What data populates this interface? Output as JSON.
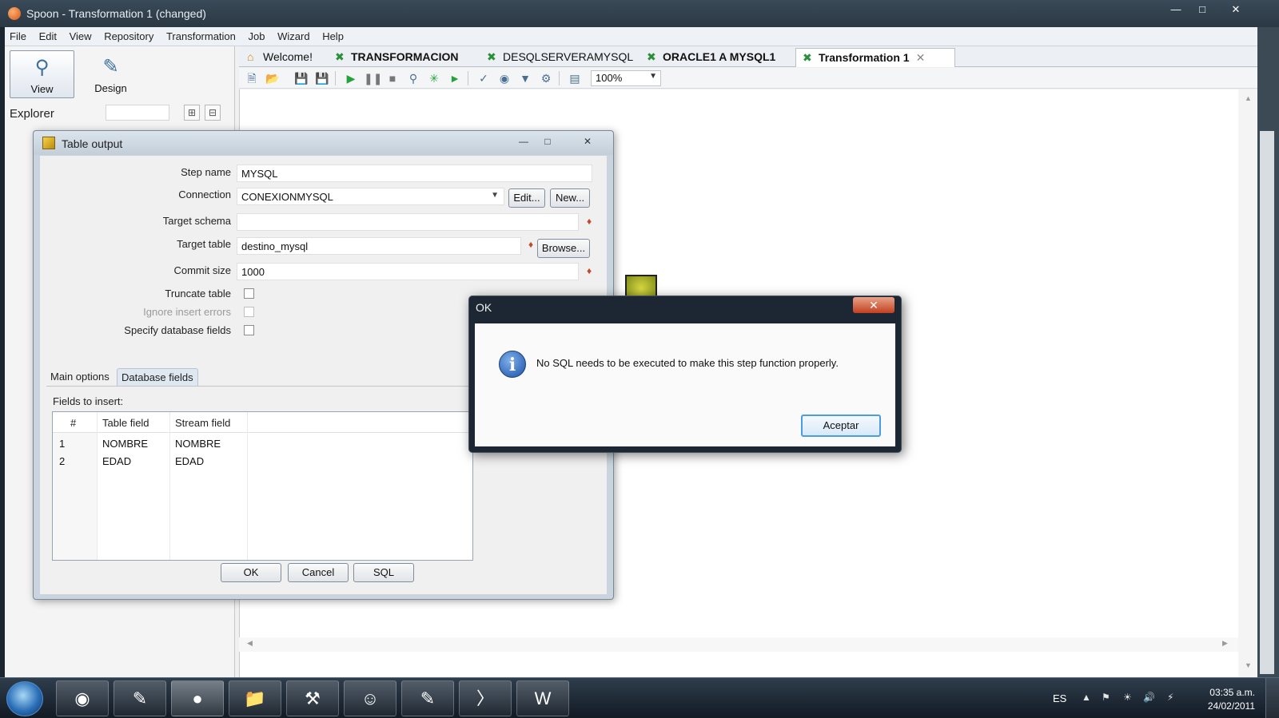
{
  "window": {
    "title": "Spoon - Transformation 1 (changed)"
  },
  "menu": [
    "File",
    "Edit",
    "View",
    "Repository",
    "Transformation",
    "Job",
    "Wizard",
    "Help"
  ],
  "perspectives": {
    "view": "View",
    "design": "Design"
  },
  "explorer": {
    "label": "Explorer"
  },
  "tabs": [
    "Welcome!",
    "TRANSFORMACION",
    "DESQLSERVERAMYSQL",
    "ORACLE1 A MYSQL1",
    "Transformation 1"
  ],
  "toolbar": {
    "zoom": "100%"
  },
  "table_output": {
    "title": "Table output",
    "step_name_label": "Step name",
    "step_name": "MYSQL",
    "connection_label": "Connection",
    "connection": "CONEXIONMYSQL",
    "edit_button": "Edit...",
    "new_button": "New...",
    "target_schema_label": "Target schema",
    "target_schema": "",
    "target_table_label": "Target table",
    "target_table": "destino_mysql",
    "browse_button": "Browse...",
    "commit_size_label": "Commit size",
    "commit_size": "1000",
    "truncate_label": "Truncate table",
    "truncate_checked": false,
    "ignore_errors_label": "Ignore insert errors",
    "ignore_errors_checked": false,
    "specify_fields_label": "Specify database fields",
    "specify_fields_checked": false,
    "subtabs": [
      "Main options",
      "Database fields"
    ],
    "fields_label": "Fields to insert:",
    "columns": [
      "#",
      "Table field",
      "Stream field"
    ],
    "rows": [
      {
        "n": "1",
        "table_field": "NOMBRE",
        "stream_field": "NOMBRE"
      },
      {
        "n": "2",
        "table_field": "EDAD",
        "stream_field": "EDAD"
      }
    ],
    "ok_button": "OK",
    "cancel_button": "Cancel",
    "sql_button": "SQL"
  },
  "message_box": {
    "title": "OK",
    "text": "No SQL needs to be executed to make this step function properly.",
    "button": "Aceptar"
  },
  "taskbar": {
    "language": "ES",
    "time": "03:35 a.m.",
    "date": "24/02/2011"
  },
  "colors": {
    "selected_tab_bg": "#ffffff",
    "dialog_frame": "#c9d4de",
    "message_title_bg": "#1c2733",
    "close_button_red": "#c2401f",
    "default_button_border": "#4a9de0"
  }
}
